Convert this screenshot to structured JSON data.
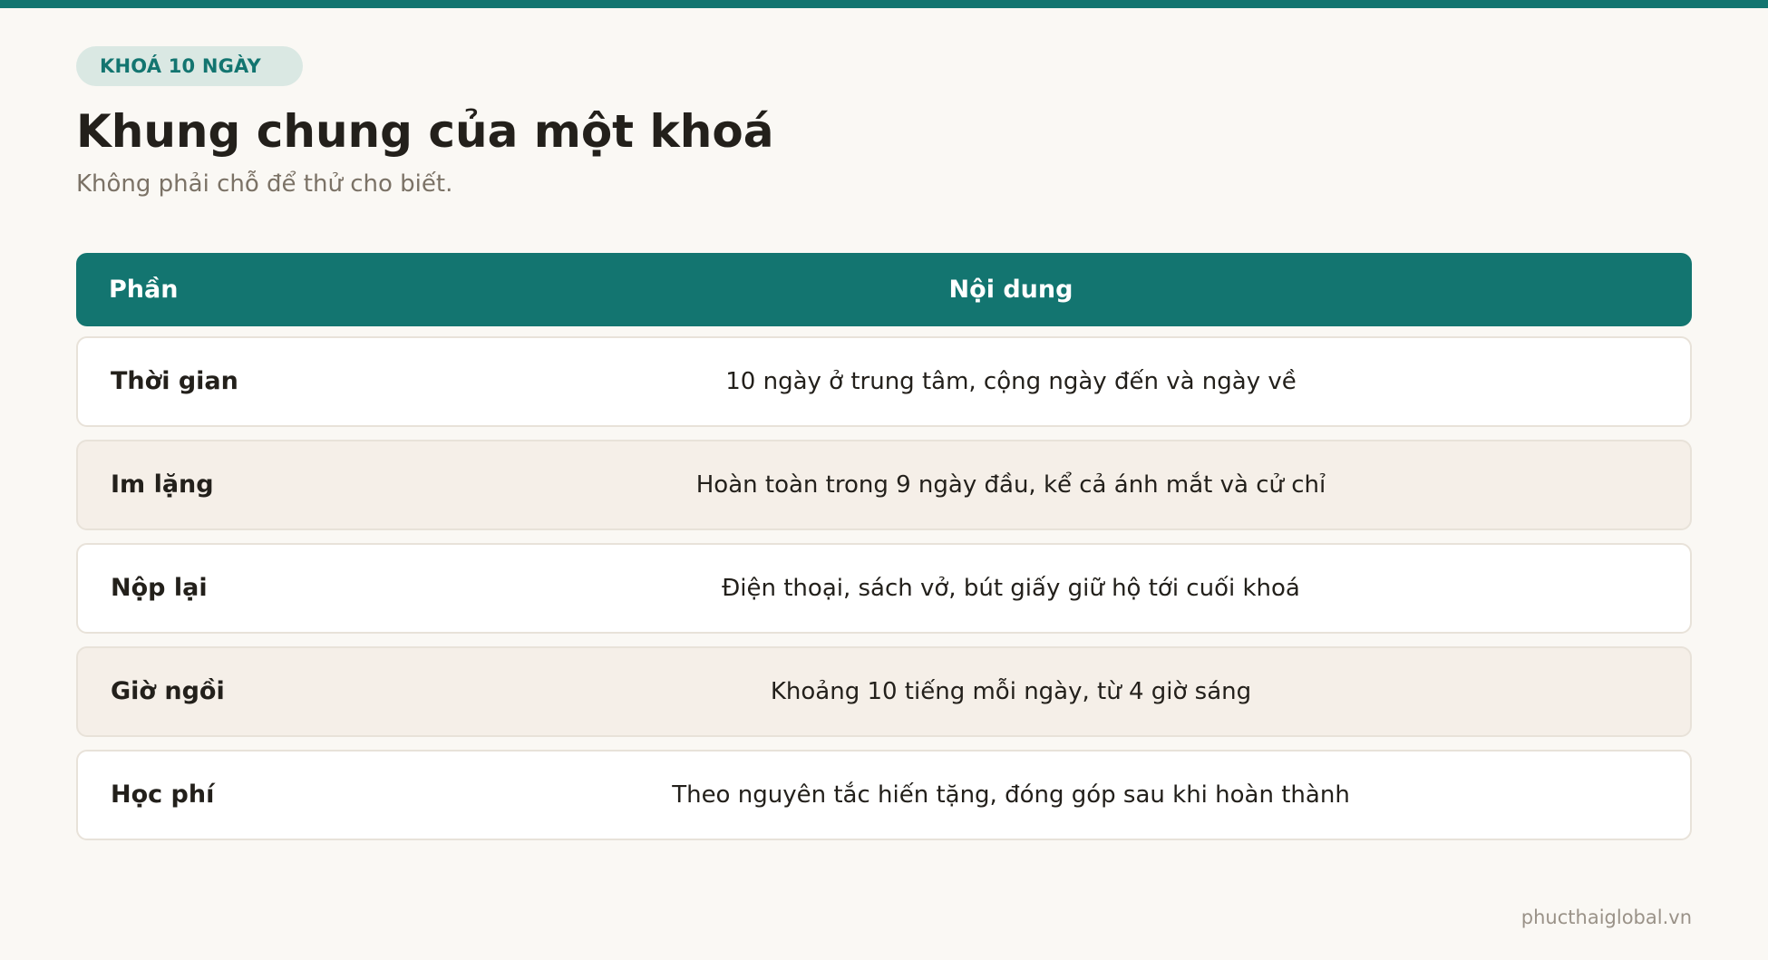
{
  "badge": {
    "label": "KHOÁ 10 NGÀY"
  },
  "header": {
    "title": "Khung chung của một khoá",
    "subtitle": "Không phải chỗ để thử cho biết."
  },
  "table": {
    "columns": [
      "Phần",
      "Nội dung"
    ],
    "rows": [
      {
        "part": "Thời gian",
        "content": "10 ngày ở trung tâm, cộng ngày đến và ngày về"
      },
      {
        "part": "Im lặng",
        "content": "Hoàn toàn trong 9 ngày đầu, kể cả ánh mắt và cử chỉ"
      },
      {
        "part": "Nộp lại",
        "content": "Điện thoại, sách vở, bút giấy giữ hộ tới cuối khoá"
      },
      {
        "part": "Giờ ngồi",
        "content": "Khoảng 10 tiếng mỗi ngày, từ 4 giờ sáng"
      },
      {
        "part": "Học phí",
        "content": "Theo nguyên tắc hiến tặng, đóng góp sau khi hoàn thành"
      }
    ]
  },
  "footer": {
    "site": "phucthaiglobal.vn"
  },
  "colors": {
    "accent": "#137570",
    "background": "#faf8f4",
    "row_alt": "#f5efe8",
    "badge_bg": "#dae8e3"
  }
}
